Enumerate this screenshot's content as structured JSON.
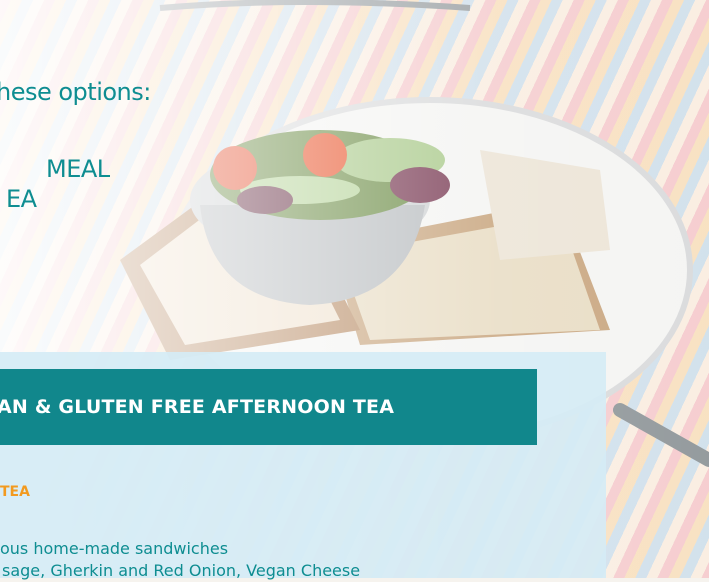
{
  "intro": {
    "heading": "hese options:",
    "options": [
      "MEAL",
      "EA"
    ]
  },
  "banner": {
    "title": "AN & GLUTEN FREE AFTERNOON TEA"
  },
  "section": {
    "label": "TEA",
    "line1": "ous home-made sandwiches",
    "line2": "sage, Gherkin and Red Onion, Vegan Cheese"
  },
  "colors": {
    "accent_teal": "#11878c",
    "text_teal": "#0e8d91",
    "label_orange": "#f29a1f",
    "panel_blue": "#d5ecf5"
  }
}
